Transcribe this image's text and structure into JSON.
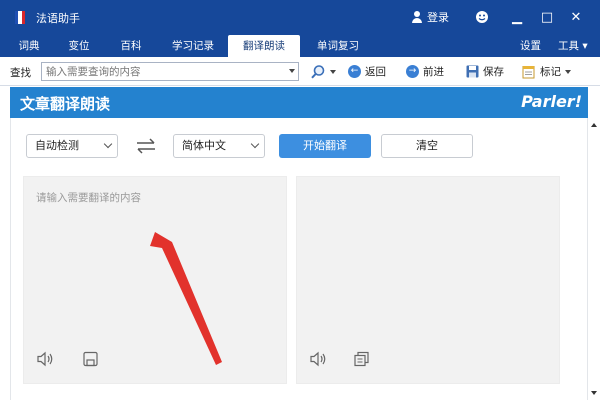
{
  "window": {
    "title": "法语助手",
    "login_label": "登录",
    "minimize_glyph": "▁",
    "restore_glyph": "□",
    "close_glyph": "✕",
    "accent_color": "#16489a"
  },
  "tabs": [
    {
      "label": "词典",
      "active": false
    },
    {
      "label": "变位",
      "active": false
    },
    {
      "label": "百科",
      "active": false
    },
    {
      "label": "学习记录",
      "active": false
    },
    {
      "label": "翻译朗读",
      "active": true
    },
    {
      "label": "单词复习",
      "active": false
    }
  ],
  "tabbar_right": {
    "settings": "设置",
    "tools": "工具 ▾"
  },
  "toolbar": {
    "search_label": "查找",
    "search_placeholder": "输入需要查询的内容",
    "back": "返回",
    "forward": "前进",
    "save": "保存",
    "bookmark": "标记",
    "back_glyph": "←",
    "forward_glyph": "→"
  },
  "banner": {
    "title": "文章翻译朗读",
    "logo": "Parler!",
    "color": "#2482cf"
  },
  "translate": {
    "source_lang": "自动检测",
    "target_lang": "简体中文",
    "start_button": "开始翻译",
    "clear_button": "清空",
    "input_placeholder": "请输入需要翻译的内容",
    "button_color": "#3d8fe0"
  }
}
